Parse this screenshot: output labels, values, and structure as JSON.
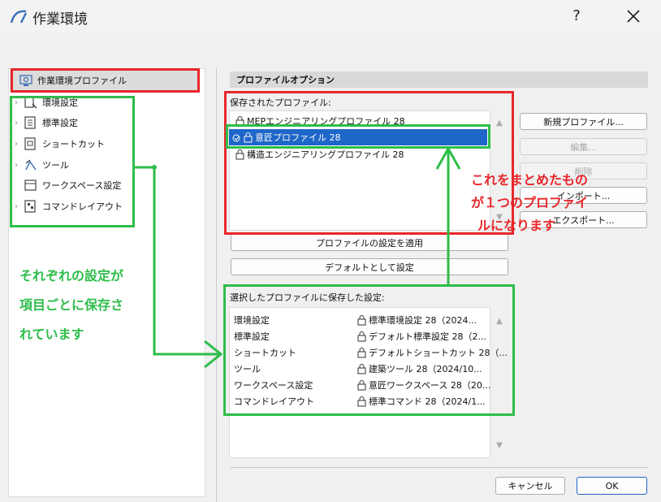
{
  "window": {
    "title": "作業環境",
    "help": "?"
  },
  "tree": {
    "root": "作業環境プロファイル",
    "items": [
      "環境設定",
      "標準設定",
      "ショートカット",
      "ツール",
      "ワークスペース設定",
      "コマンドレイアウト"
    ]
  },
  "profile_options": {
    "header": "プロファイルオプション",
    "saved_label": "保存されたプロファイル:",
    "profiles": [
      "MEPエンジニアリングプロファイル 28",
      "意匠プロファイル 28",
      "構造エンジニアリングプロファイル 28"
    ],
    "selected_index": 1,
    "buttons": {
      "new": "新規プロファイル...",
      "edit": "編集...",
      "delete": "削除",
      "import": "インポート...",
      "export": "エクスポート..."
    },
    "apply": "プロファイルの設定を適用",
    "set_default": "デフォルトとして設定",
    "settings_label": "選択したプロファイルに保存した設定:",
    "settings": [
      {
        "name": "環境設定",
        "value": "標準環境設定 28（2024..."
      },
      {
        "name": "標準設定",
        "value": "デフォルト標準設定 28（2..."
      },
      {
        "name": "ショートカット",
        "value": "デフォルトショートカット 28（..."
      },
      {
        "name": "ツール",
        "value": "建築ツール 28（2024/10..."
      },
      {
        "name": "ワークスペース設定",
        "value": "意匠ワークスペース 28（20..."
      },
      {
        "name": "コマンドレイアウト",
        "value": "標準コマンド 28（2024/1..."
      }
    ]
  },
  "footer": {
    "cancel": "キャンセル",
    "ok": "OK"
  },
  "annotations": {
    "green_text": [
      "それぞれの設定が",
      "項目ごとに保存さ",
      "れています"
    ],
    "red_text": [
      "これをまとめたもの",
      "が１つのプロファイ",
      "ルになります"
    ],
    "colors": {
      "red": "#e8272b",
      "green": "#2ebd4a",
      "selection": "#1e66c8"
    }
  }
}
